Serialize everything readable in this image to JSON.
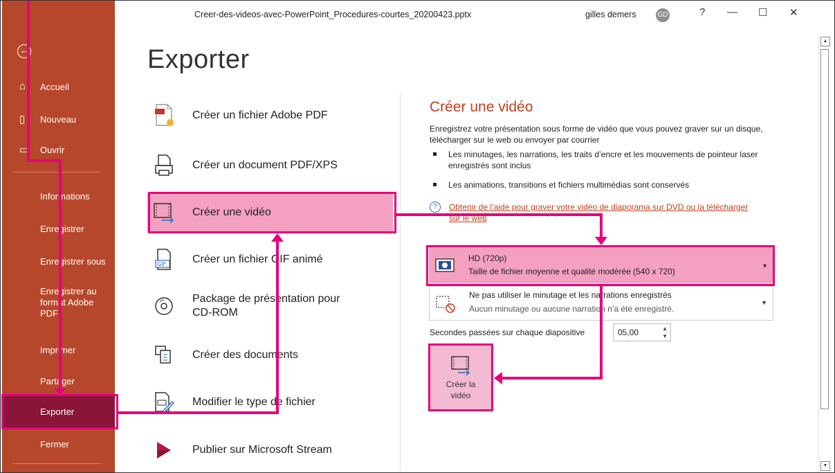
{
  "window": {
    "filename": "Creer-des-videos-avec-PowerPoint_Procedures-courtes_20200423.pptx",
    "user": "gilles demers",
    "avatar_initials": "GD",
    "help": "?",
    "minimize": "—",
    "maximize": "☐",
    "close": "✕"
  },
  "sidebar": {
    "back_icon": "back-arrow-icon",
    "items": [
      {
        "label": "Accueil"
      },
      {
        "label": "Nouveau"
      },
      {
        "label": "Ouvrir"
      },
      {
        "label": "Informations"
      },
      {
        "label": "Enregistrer"
      },
      {
        "label": "Enregistrer sous"
      },
      {
        "label": "Enregistrer au format Adobe PDF"
      },
      {
        "label": "Imprimer"
      },
      {
        "label": "Partager"
      },
      {
        "label": "Exporter"
      },
      {
        "label": "Fermer"
      }
    ],
    "active": "Exporter"
  },
  "page_title": "Exporter",
  "options": [
    {
      "label": "Créer un fichier Adobe PDF",
      "icon": "adobe-pdf-icon"
    },
    {
      "label": "Créer un document PDF/XPS",
      "icon": "pdf-xps-icon"
    },
    {
      "label": "Créer une vidéo",
      "icon": "video-icon"
    },
    {
      "label": "Créer un fichier GIF animé",
      "icon": "gif-icon"
    },
    {
      "label": "Package de présentation pour CD-ROM",
      "icon": "cd-icon"
    },
    {
      "label": "Créer des documents",
      "icon": "handouts-icon"
    },
    {
      "label": "Modifier le type de fichier",
      "icon": "change-file-type-icon"
    },
    {
      "label": "Publier sur Microsoft Stream",
      "icon": "stream-icon"
    }
  ],
  "selected_option": "Créer une vidéo",
  "panel": {
    "title": "Créer une vidéo",
    "description": "Enregistrez votre présentation sous forme de vidéo que vous pouvez graver sur un disque, télécharger sur le web ou envoyer par courrier",
    "bullets": [
      "Les minutages, les narrations, les traits d’encre et les mouvements de pointeur laser enregistrés sont inclus",
      "Les animations, transitions et fichiers multimédias sont conservés"
    ],
    "help_link": "Obtenir de l’aide pour graver votre vidéo de diaporama sur DVD ou la télécharger sur le web",
    "quality": {
      "title": "HD (720p)",
      "subtitle": "Taille de fichier moyenne et qualité modérée (540 x 720)"
    },
    "timing": {
      "title": "Ne pas utiliser le minutage et les narrations enregistrés",
      "subtitle": "Aucun minutage ou aucune narration n’a été enregistré."
    },
    "seconds_label": "Secondes passées sur chaque diapositive",
    "seconds_value": "05,00",
    "create_button": "Créer la vidéo",
    "highlight_color": "#e6007e"
  }
}
